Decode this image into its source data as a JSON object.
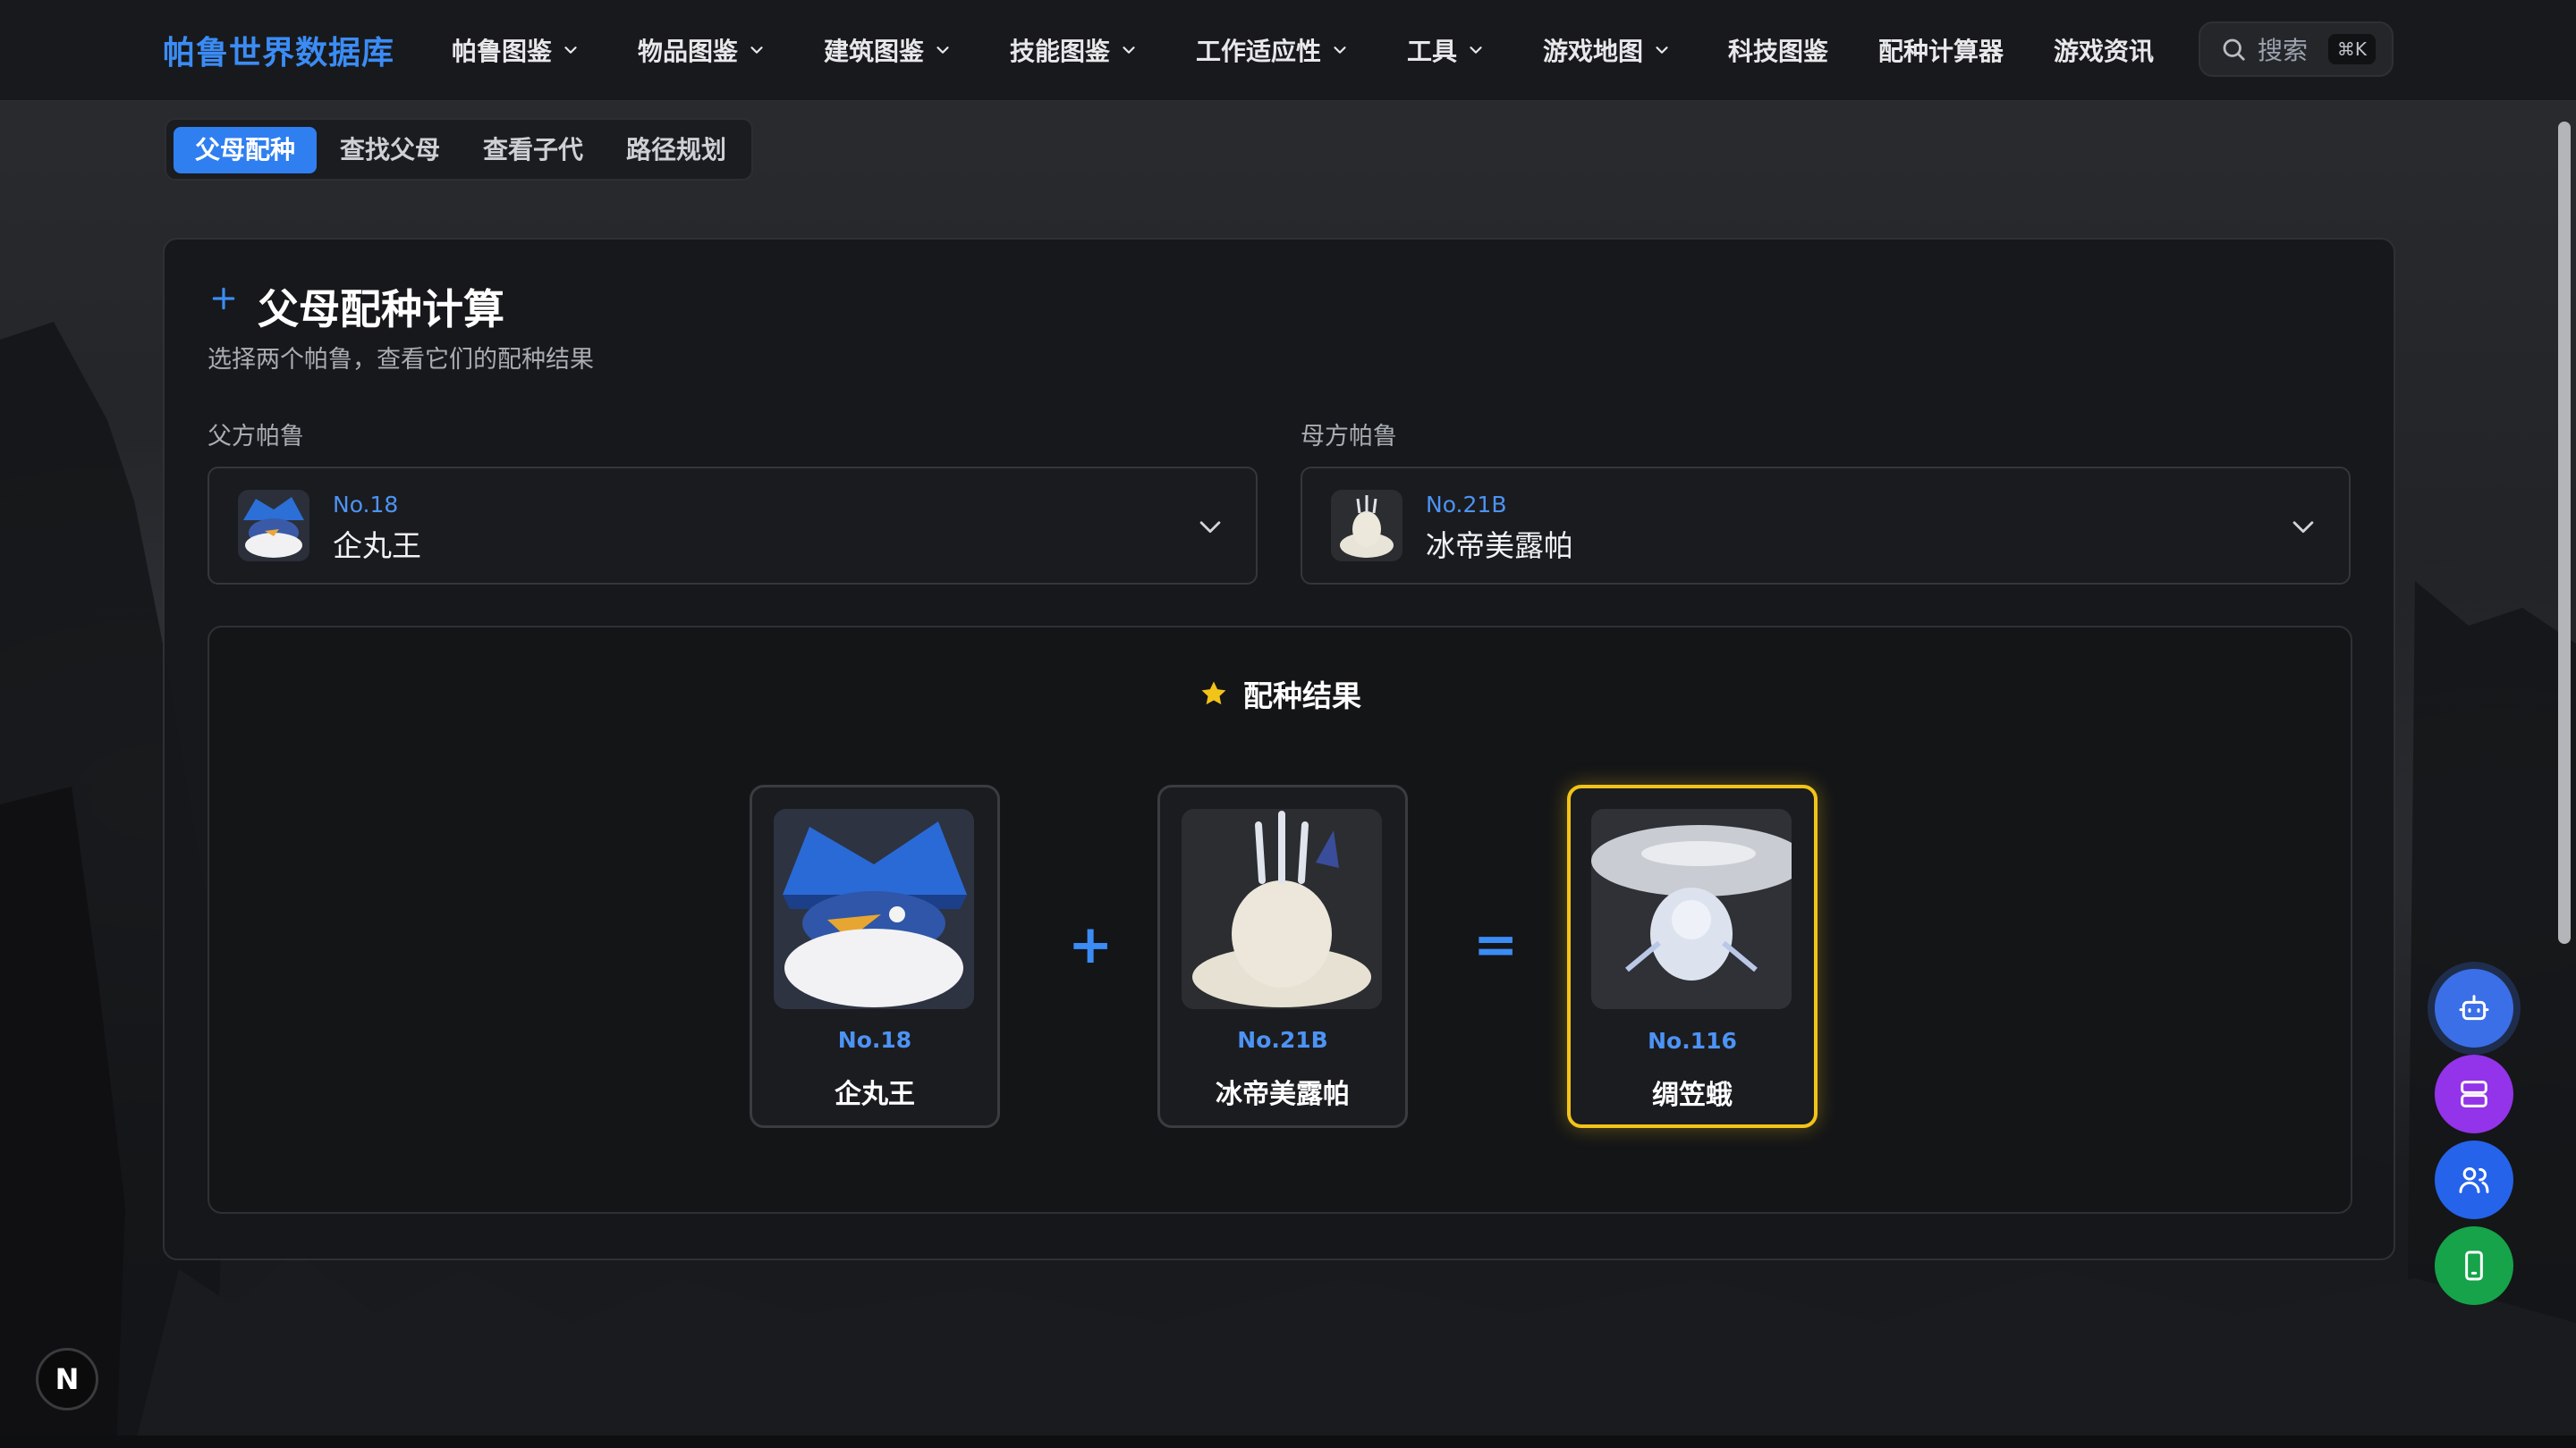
{
  "site": {
    "brand": "帕鲁世界数据库"
  },
  "nav": {
    "items": [
      {
        "label": "帕鲁图鉴",
        "dropdown": true
      },
      {
        "label": "物品图鉴",
        "dropdown": true
      },
      {
        "label": "建筑图鉴",
        "dropdown": true
      },
      {
        "label": "技能图鉴",
        "dropdown": true
      },
      {
        "label": "工作适应性",
        "dropdown": true
      },
      {
        "label": "工具",
        "dropdown": true
      },
      {
        "label": "游戏地图",
        "dropdown": true
      },
      {
        "label": "科技图鉴",
        "dropdown": false
      },
      {
        "label": "配种计算器",
        "dropdown": false
      },
      {
        "label": "游戏资讯",
        "dropdown": false
      }
    ],
    "search": {
      "label": "搜索",
      "shortcut": "⌘K"
    }
  },
  "tabs": {
    "items": [
      "父母配种",
      "查找父母",
      "查看子代",
      "路径规划"
    ],
    "active": "父母配种"
  },
  "breeding": {
    "title": "父母配种计算",
    "subtitle": "选择两个帕鲁，查看它们的配种结果",
    "father": {
      "label": "父方帕鲁",
      "no": "No.18",
      "name": "企丸王"
    },
    "mother": {
      "label": "母方帕鲁",
      "no": "No.21B",
      "name": "冰帝美露帕"
    }
  },
  "result": {
    "heading": "配种结果",
    "parent1": {
      "no": "No.18",
      "name": "企丸王"
    },
    "parent2": {
      "no": "No.21B",
      "name": "冰帝美露帕"
    },
    "child": {
      "no": "No.116",
      "name": "绸笠蛾"
    },
    "plus_symbol": "+",
    "equals_symbol": "="
  },
  "floating_buttons": [
    {
      "icon": "robot-icon",
      "color": "#3b6fe8"
    },
    {
      "icon": "server-icon",
      "color": "#9333ea"
    },
    {
      "icon": "users-icon",
      "color": "#2563eb"
    },
    {
      "icon": "mobile-icon",
      "color": "#16a34a"
    }
  ],
  "badge": {
    "letter": "N"
  },
  "colors": {
    "accent": "#3b8cf5",
    "highlight": "#f2c319",
    "tab_active": "#2f7ff0"
  }
}
